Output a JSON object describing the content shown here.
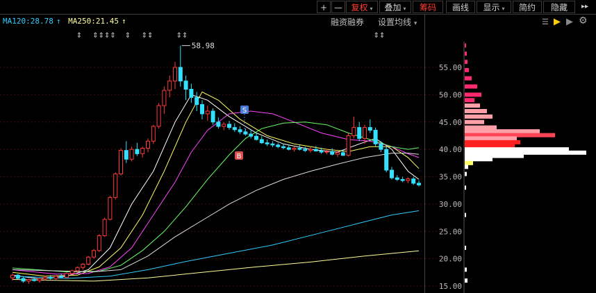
{
  "toolbar": {
    "plus": "+",
    "minus": "—",
    "fuquan": "复权",
    "diejia": "叠加",
    "chouma": "筹码",
    "huaxian": "画线",
    "xianshi": "显示",
    "jianyue": "简约",
    "yincang": "隐藏",
    "expand": "▸▸",
    "settings": "⚙"
  },
  "legend": {
    "ma120": "MA120:28.78",
    "ma250": "MA250:21.45",
    "arrow": "↑",
    "margin_link": "融资融券",
    "ma_setting": "设置均线",
    "caret": "▾"
  },
  "chart_data": {
    "type": "candlestick",
    "y_ticks": [
      "55.00",
      "50.00",
      "45.00",
      "40.00",
      "35.00",
      "30.00",
      "25.00",
      "20.00",
      "15.00"
    ],
    "ylim": [
      14,
      60
    ],
    "max_label": "58.98",
    "buy_marker": "B",
    "sell_marker": "S",
    "event_marks": [
      "⇕",
      "⇕⇕⇕⇕",
      "⇕",
      "⇕⇕",
      "⇕⇕",
      "⇕⇕"
    ],
    "candles": [
      [
        16.5,
        17.3,
        16.0,
        17.0
      ],
      [
        17.0,
        17.2,
        16.2,
        16.4
      ],
      [
        16.4,
        16.8,
        15.6,
        15.9
      ],
      [
        15.9,
        16.4,
        15.4,
        16.2
      ],
      [
        16.2,
        16.7,
        15.8,
        16.0
      ],
      [
        16.0,
        16.5,
        15.6,
        16.3
      ],
      [
        16.3,
        16.9,
        16.0,
        16.6
      ],
      [
        16.6,
        17.0,
        16.2,
        16.4
      ],
      [
        16.4,
        16.9,
        16.1,
        16.8
      ],
      [
        16.8,
        17.2,
        16.5,
        16.6
      ],
      [
        16.6,
        17.5,
        16.4,
        17.3
      ],
      [
        17.3,
        18.0,
        17.0,
        17.8
      ],
      [
        17.8,
        18.6,
        17.5,
        18.4
      ],
      [
        18.4,
        19.2,
        18.0,
        19.0
      ],
      [
        19.0,
        20.5,
        18.8,
        20.3
      ],
      [
        20.3,
        21.8,
        20.0,
        21.5
      ],
      [
        21.5,
        24.5,
        21.2,
        24.2
      ],
      [
        24.2,
        27.5,
        24.0,
        27.2
      ],
      [
        27.2,
        31.5,
        27.0,
        31.2
      ],
      [
        31.2,
        35.8,
        30.8,
        35.5
      ],
      [
        35.5,
        40.2,
        35.2,
        39.8
      ],
      [
        39.8,
        41.5,
        37.5,
        38.2
      ],
      [
        38.2,
        40.5,
        37.8,
        40.0
      ],
      [
        40.0,
        41.2,
        38.8,
        39.2
      ],
      [
        39.2,
        40.5,
        38.5,
        40.2
      ],
      [
        40.2,
        42.0,
        39.5,
        41.5
      ],
      [
        41.5,
        44.5,
        41.0,
        44.2
      ],
      [
        44.2,
        48.5,
        43.8,
        48.0
      ],
      [
        48.0,
        51.5,
        46.5,
        50.8
      ],
      [
        50.8,
        53.5,
        49.5,
        52.5
      ],
      [
        52.5,
        56.0,
        51.0,
        55.0
      ],
      [
        55.0,
        58.98,
        51.5,
        52.5
      ],
      [
        52.5,
        53.5,
        49.0,
        51.0
      ],
      [
        51.0,
        52.0,
        48.5,
        49.5
      ],
      [
        49.5,
        50.5,
        47.0,
        48.2
      ],
      [
        48.2,
        49.0,
        45.5,
        46.5
      ],
      [
        46.5,
        48.0,
        45.2,
        47.0
      ],
      [
        47.0,
        47.5,
        44.5,
        45.0
      ],
      [
        45.0,
        45.8,
        43.8,
        44.2
      ],
      [
        44.2,
        45.0,
        43.5,
        44.6
      ],
      [
        44.6,
        45.2,
        43.6,
        44.0
      ],
      [
        44.0,
        44.8,
        43.2,
        43.6
      ],
      [
        43.6,
        44.2,
        42.8,
        43.2
      ],
      [
        43.2,
        43.8,
        42.5,
        42.8
      ],
      [
        42.8,
        43.6,
        42.0,
        42.4
      ],
      [
        42.4,
        43.0,
        41.6,
        41.8
      ],
      [
        41.8,
        42.4,
        41.0,
        41.2
      ],
      [
        41.2,
        41.8,
        40.6,
        41.0
      ],
      [
        41.0,
        41.5,
        40.4,
        40.8
      ],
      [
        40.8,
        41.2,
        40.2,
        40.5
      ],
      [
        40.5,
        41.0,
        40.0,
        40.3
      ],
      [
        40.3,
        40.8,
        39.8,
        40.0
      ],
      [
        40.0,
        40.6,
        39.6,
        40.2
      ],
      [
        40.2,
        40.8,
        39.8,
        40.0
      ],
      [
        40.0,
        40.5,
        39.5,
        39.8
      ],
      [
        39.8,
        40.4,
        39.4,
        40.0
      ],
      [
        40.0,
        40.6,
        39.6,
        39.7
      ],
      [
        39.7,
        40.3,
        39.2,
        39.5
      ],
      [
        39.5,
        40.1,
        39.1,
        39.6
      ],
      [
        39.6,
        40.2,
        38.9,
        39.1
      ],
      [
        39.1,
        39.8,
        38.6,
        39.4
      ],
      [
        39.4,
        40.0,
        38.8,
        38.9
      ],
      [
        38.9,
        43.0,
        38.7,
        42.5
      ],
      [
        42.5,
        46.0,
        42.0,
        44.0
      ],
      [
        44.0,
        45.0,
        41.5,
        42.0
      ],
      [
        42.0,
        44.5,
        41.0,
        44.0
      ],
      [
        44.0,
        45.5,
        43.0,
        43.5
      ],
      [
        43.5,
        44.0,
        40.5,
        41.0
      ],
      [
        41.0,
        41.5,
        39.5,
        40.0
      ],
      [
        40.0,
        40.5,
        35.8,
        36.2
      ],
      [
        36.2,
        36.8,
        34.5,
        34.8
      ],
      [
        34.8,
        35.3,
        34.2,
        34.5
      ],
      [
        34.5,
        35.0,
        34.0,
        34.3
      ],
      [
        34.3,
        34.9,
        33.8,
        34.6
      ],
      [
        34.6,
        35.0,
        33.5,
        33.8
      ],
      [
        33.8,
        34.3,
        33.2,
        33.5
      ]
    ],
    "ma_lines": [
      {
        "color": "#ffffff",
        "points": [
          [
            0,
            17.0
          ],
          [
            5,
            16.3
          ],
          [
            10,
            16.8
          ],
          [
            14,
            18.0
          ],
          [
            18,
            22.0
          ],
          [
            22,
            30.0
          ],
          [
            26,
            36.0
          ],
          [
            30,
            45.0
          ],
          [
            33,
            50.0
          ],
          [
            36,
            49.0
          ],
          [
            40,
            46.0
          ],
          [
            45,
            43.0
          ],
          [
            50,
            41.0
          ],
          [
            55,
            40.0
          ],
          [
            60,
            39.5
          ],
          [
            64,
            41.0
          ],
          [
            67,
            42.0
          ],
          [
            70,
            40.0
          ],
          [
            73,
            36.0
          ],
          [
            75,
            34.5
          ]
        ]
      },
      {
        "color": "#ffff66",
        "points": [
          [
            0,
            17.5
          ],
          [
            6,
            16.8
          ],
          [
            12,
            17.0
          ],
          [
            16,
            18.5
          ],
          [
            20,
            22.0
          ],
          [
            24,
            28.0
          ],
          [
            28,
            36.0
          ],
          [
            32,
            45.0
          ],
          [
            35,
            50.5
          ],
          [
            38,
            49.0
          ],
          [
            42,
            45.5
          ],
          [
            47,
            42.5
          ],
          [
            52,
            41.0
          ],
          [
            58,
            40.0
          ],
          [
            62,
            39.6
          ],
          [
            66,
            40.5
          ],
          [
            70,
            40.5
          ],
          [
            73,
            38.5
          ],
          [
            75,
            36.5
          ]
        ]
      },
      {
        "color": "#ff44ff",
        "points": [
          [
            0,
            18.0
          ],
          [
            8,
            17.2
          ],
          [
            14,
            17.3
          ],
          [
            18,
            18.5
          ],
          [
            22,
            22.0
          ],
          [
            26,
            28.0
          ],
          [
            30,
            34.0
          ],
          [
            33,
            39.5
          ],
          [
            36,
            43.5
          ],
          [
            40,
            46.5
          ],
          [
            44,
            47.0
          ],
          [
            48,
            46.5
          ],
          [
            52,
            45.0
          ],
          [
            57,
            43.0
          ],
          [
            62,
            41.8
          ],
          [
            66,
            41.5
          ],
          [
            70,
            40.5
          ],
          [
            73,
            39.2
          ],
          [
            75,
            38.5
          ]
        ]
      },
      {
        "color": "#66ff66",
        "points": [
          [
            0,
            18.3
          ],
          [
            10,
            17.6
          ],
          [
            16,
            17.7
          ],
          [
            20,
            18.8
          ],
          [
            24,
            21.5
          ],
          [
            28,
            25.0
          ],
          [
            32,
            29.5
          ],
          [
            36,
            34.5
          ],
          [
            40,
            39.0
          ],
          [
            43,
            42.0
          ],
          [
            46,
            43.8
          ],
          [
            50,
            44.8
          ],
          [
            54,
            45.0
          ],
          [
            58,
            44.5
          ],
          [
            62,
            43.0
          ],
          [
            66,
            41.8
          ],
          [
            70,
            40.5
          ],
          [
            73,
            40.0
          ],
          [
            75,
            40.3
          ]
        ]
      },
      {
        "color": "#dddddd",
        "points": [
          [
            0,
            18.0
          ],
          [
            15,
            17.6
          ],
          [
            20,
            18.0
          ],
          [
            25,
            20.5
          ],
          [
            30,
            24.0
          ],
          [
            35,
            27.0
          ],
          [
            40,
            30.0
          ],
          [
            45,
            32.5
          ],
          [
            50,
            34.5
          ],
          [
            55,
            36.0
          ],
          [
            60,
            37.3
          ],
          [
            65,
            38.5
          ],
          [
            70,
            39.3
          ],
          [
            73,
            39.3
          ],
          [
            75,
            39.1
          ]
        ]
      },
      {
        "color": "#33ccff",
        "points": [
          [
            0,
            16.8
          ],
          [
            10,
            16.4
          ],
          [
            18,
            16.8
          ],
          [
            25,
            18.0
          ],
          [
            32,
            19.5
          ],
          [
            40,
            21.0
          ],
          [
            48,
            22.5
          ],
          [
            56,
            24.5
          ],
          [
            64,
            26.5
          ],
          [
            70,
            28.0
          ],
          [
            75,
            28.78
          ]
        ]
      },
      {
        "color": "#ffff99",
        "points": [
          [
            0,
            16.2
          ],
          [
            15,
            15.9
          ],
          [
            25,
            16.5
          ],
          [
            35,
            17.5
          ],
          [
            45,
            18.5
          ],
          [
            55,
            19.4
          ],
          [
            65,
            20.5
          ],
          [
            75,
            21.45
          ]
        ]
      }
    ],
    "chip_distribution": [
      {
        "y": 59.0,
        "w": 2,
        "color": "#ff2a6d"
      },
      {
        "y": 57.5,
        "w": 3,
        "color": "#ff2a6d"
      },
      {
        "y": 56.0,
        "w": 4,
        "color": "#ff2a6d"
      },
      {
        "y": 54.5,
        "w": 6,
        "color": "#ff2a6d"
      },
      {
        "y": 53.0,
        "w": 10,
        "color": "#ff2a6d"
      },
      {
        "y": 51.5,
        "w": 18,
        "color": "#ff2a6d"
      },
      {
        "y": 50.0,
        "w": 24,
        "color": "#ff2a6d"
      },
      {
        "y": 49.0,
        "w": 14,
        "color": "#ff2a6d"
      },
      {
        "y": 48.0,
        "w": 22,
        "color": "#ffa0a8"
      },
      {
        "y": 47.0,
        "w": 32,
        "color": "#ffa0a8"
      },
      {
        "y": 46.0,
        "w": 40,
        "color": "#ffa0a8"
      },
      {
        "y": 45.0,
        "w": 28,
        "color": "#ffa0a8"
      },
      {
        "y": 44.0,
        "w": 46,
        "color": "#ffa0a8"
      },
      {
        "y": 43.3,
        "w": 108,
        "color": "#ffa0a8"
      },
      {
        "y": 42.6,
        "w": 130,
        "color": "#ff4455"
      },
      {
        "y": 42.0,
        "w": 75,
        "color": "#ffa0a8"
      },
      {
        "y": 41.3,
        "w": 80,
        "color": "#ff2020"
      },
      {
        "y": 40.6,
        "w": 72,
        "color": "#ff2020"
      },
      {
        "y": 40.0,
        "w": 150,
        "color": "#ffffff"
      },
      {
        "y": 39.4,
        "w": 175,
        "color": "#ffffff"
      },
      {
        "y": 38.8,
        "w": 85,
        "color": "#ffffff"
      },
      {
        "y": 38.2,
        "w": 40,
        "color": "#ffffff"
      },
      {
        "y": 37.5,
        "w": 12,
        "color": "#ffff66"
      },
      {
        "y": 36.8,
        "w": 5,
        "color": "#ffffff"
      },
      {
        "y": 35.5,
        "w": 3,
        "color": "#ffffff"
      },
      {
        "y": 33.0,
        "w": 2,
        "color": "#ffffff"
      },
      {
        "y": 28.0,
        "w": 2,
        "color": "#ffffff"
      },
      {
        "y": 22.0,
        "w": 2,
        "color": "#ffffff"
      },
      {
        "y": 18.0,
        "w": 3,
        "color": "#ffffff"
      },
      {
        "y": 16.0,
        "w": 4,
        "color": "#ffffff"
      }
    ]
  }
}
